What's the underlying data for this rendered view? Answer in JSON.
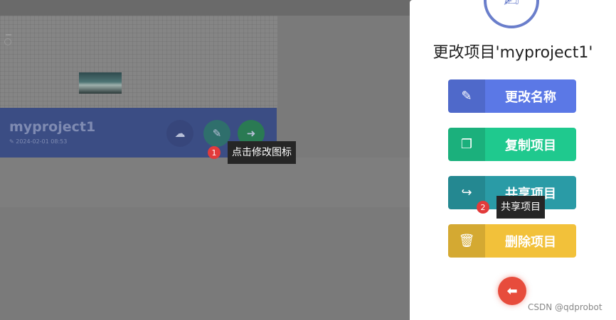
{
  "project_card": {
    "name": "myproject1",
    "date": "✎ 2024-02-01 08:53"
  },
  "steps": [
    {
      "number": "1",
      "tooltip": "点击修改图标"
    },
    {
      "number": "2",
      "tooltip": "共享项目"
    }
  ],
  "modal": {
    "title": "更改项目'myproject1'",
    "actions": {
      "rename": "更改名称",
      "copy": "复制项目",
      "share": "共享项目",
      "delete": "删除项目"
    }
  },
  "colors": {
    "rename": "#5b78e6",
    "copy": "#1fc98e",
    "share": "#2a9ba6",
    "delete": "#f2c13a",
    "back": "#e74c3c",
    "badge": "#e23b3b"
  },
  "watermark": "CSDN @qdprobot"
}
